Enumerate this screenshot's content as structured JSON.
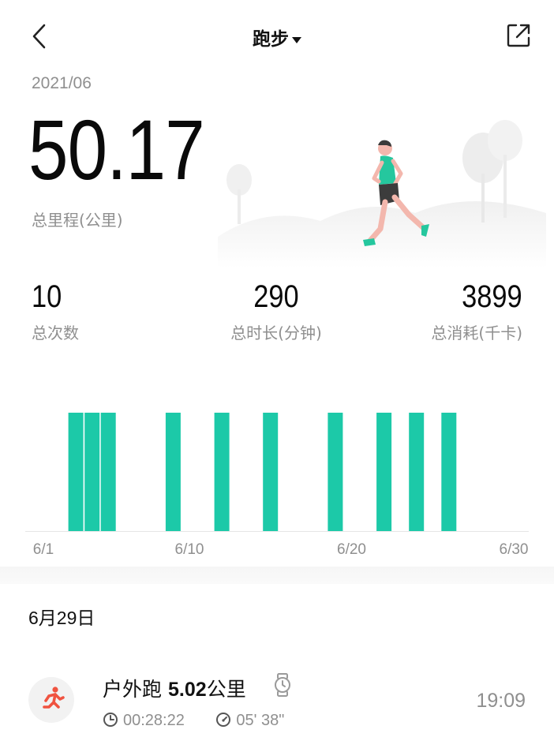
{
  "header": {
    "title": "跑步",
    "back_icon": "chevron-left-icon",
    "share_icon": "share-external-icon"
  },
  "summary": {
    "month": "2021/06",
    "total_distance": "50.17",
    "total_distance_label": "总里程(公里)"
  },
  "stats": [
    {
      "value": "10",
      "label": "总次数"
    },
    {
      "value": "290",
      "label": "总时长(分钟)"
    },
    {
      "value": "3899",
      "label": "总消耗(千卡)"
    }
  ],
  "chart_data": {
    "type": "bar",
    "x_ticks": [
      "6/1",
      "6/10",
      "6/20",
      "6/30"
    ],
    "bars_days": [
      3,
      4,
      5,
      9,
      12,
      15,
      19,
      22,
      24,
      26
    ],
    "bar_color": "#1cc9a8",
    "grid": false
  },
  "records": {
    "date": "6月29日",
    "items": [
      {
        "type_label": "户外跑",
        "distance_value": "5.02",
        "distance_unit": "公里",
        "duration": "00:28:22",
        "pace": "05' 38\"",
        "time": "19:09",
        "icon": "running-person-icon",
        "icon_color": "#f05340"
      }
    ]
  }
}
